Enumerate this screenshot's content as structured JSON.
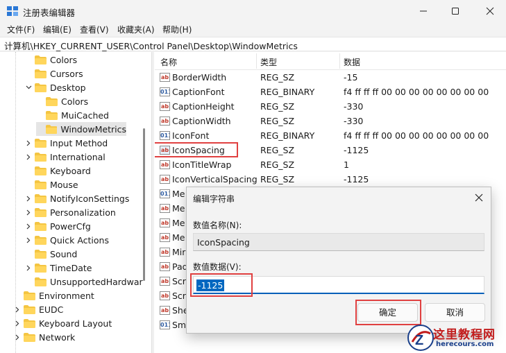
{
  "window": {
    "title": "注册表编辑器",
    "icon": "regedit-icon"
  },
  "menu": [
    "文件(F)",
    "编辑(E)",
    "查看(V)",
    "收藏夹(A)",
    "帮助(H)"
  ],
  "address": "计算机\\HKEY_CURRENT_USER\\Control Panel\\Desktop\\WindowMetrics",
  "tree": [
    {
      "label": "Colors",
      "expander": "none"
    },
    {
      "label": "Cursors",
      "expander": "none"
    },
    {
      "label": "Desktop",
      "expander": "down"
    },
    {
      "label": "Colors",
      "expander": "none"
    },
    {
      "label": "MuiCached",
      "expander": "none"
    },
    {
      "label": "WindowMetrics",
      "expander": "none",
      "selected": true
    },
    {
      "label": "Input Method",
      "expander": "right"
    },
    {
      "label": "International",
      "expander": "right"
    },
    {
      "label": "Keyboard",
      "expander": "none"
    },
    {
      "label": "Mouse",
      "expander": "none"
    },
    {
      "label": "NotifyIconSettings",
      "expander": "right"
    },
    {
      "label": "Personalization",
      "expander": "right"
    },
    {
      "label": "PowerCfg",
      "expander": "right"
    },
    {
      "label": "Quick Actions",
      "expander": "right"
    },
    {
      "label": "Sound",
      "expander": "none"
    },
    {
      "label": "TimeDate",
      "expander": "right"
    },
    {
      "label": "UnsupportedHardwar",
      "expander": "none"
    },
    {
      "label": "Environment",
      "expander": "none"
    },
    {
      "label": "EUDC",
      "expander": "right"
    },
    {
      "label": "Keyboard Layout",
      "expander": "right"
    },
    {
      "label": "Network",
      "expander": "right"
    }
  ],
  "list": {
    "headers": [
      "名称",
      "类型",
      "数据"
    ],
    "rows": [
      {
        "name": "BorderWidth",
        "type": "REG_SZ",
        "data": "-15",
        "icon": "ab"
      },
      {
        "name": "CaptionFont",
        "type": "REG_BINARY",
        "data": "f4 ff ff ff 00 00 00 00 00 00 00 00",
        "icon": "bin"
      },
      {
        "name": "CaptionHeight",
        "type": "REG_SZ",
        "data": "-330",
        "icon": "ab"
      },
      {
        "name": "CaptionWidth",
        "type": "REG_SZ",
        "data": "-330",
        "icon": "ab"
      },
      {
        "name": "IconFont",
        "type": "REG_BINARY",
        "data": "f4 ff ff ff 00 00 00 00 00 00 00 00",
        "icon": "bin"
      },
      {
        "name": "IconSpacing",
        "type": "REG_SZ",
        "data": "-1125",
        "icon": "ab",
        "selected": true
      },
      {
        "name": "IconTitleWrap",
        "type": "REG_SZ",
        "data": "1",
        "icon": "ab"
      },
      {
        "name": "IconVerticalSpacing",
        "type": "REG_SZ",
        "data": "-1125",
        "icon": "ab"
      },
      {
        "name": "Me",
        "type": "",
        "data": "",
        "icon": "bin"
      },
      {
        "name": "Me",
        "type": "",
        "data": "",
        "icon": "ab"
      },
      {
        "name": "Me",
        "type": "",
        "data": "",
        "icon": "ab"
      },
      {
        "name": "Me",
        "type": "",
        "data": "",
        "icon": "ab"
      },
      {
        "name": "Mir",
        "type": "",
        "data": "",
        "icon": "ab"
      },
      {
        "name": "Pad",
        "type": "",
        "data": "",
        "icon": "ab"
      },
      {
        "name": "Scr",
        "type": "",
        "data": "",
        "icon": "ab"
      },
      {
        "name": "Scr",
        "type": "",
        "data": "",
        "icon": "ab"
      },
      {
        "name": "She",
        "type": "",
        "data": "",
        "icon": "ab"
      },
      {
        "name": "Sm",
        "type": "",
        "data": "",
        "icon": "bin"
      }
    ]
  },
  "dialog": {
    "title": "编辑字符串",
    "name_label": "数值名称(N):",
    "name_value": "IconSpacing",
    "data_label": "数值数据(V):",
    "data_value": "-1125",
    "ok_label": "确定",
    "cancel_label": "取消"
  },
  "watermark": {
    "title": "这里教程网",
    "url": "herecours.com"
  },
  "colors": {
    "accent": "#0067c0",
    "highlight": "#e04040",
    "folder": "#f4c542"
  }
}
